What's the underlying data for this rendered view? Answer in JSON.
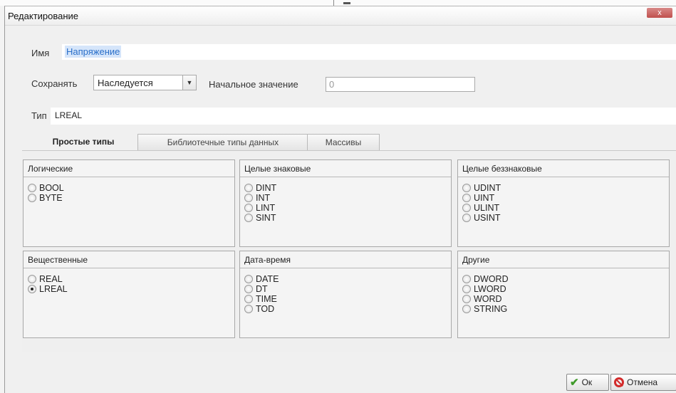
{
  "window": {
    "title": "Редактирование",
    "close_label": "x"
  },
  "form": {
    "name_label": "Имя",
    "name_value": "Напряжение",
    "save_label": "Сохранять",
    "save_value": "Наследуется",
    "initial_label": "Начальное значение",
    "initial_placeholder": "0",
    "type_label": "Тип",
    "type_value": "LREAL"
  },
  "tabs": [
    "Простые типы",
    "Библиотечные типы данных",
    "Массивы"
  ],
  "groups": [
    {
      "title": "Логические",
      "options": [
        "BOOL",
        "BYTE"
      ]
    },
    {
      "title": "Целые знаковые",
      "options": [
        "DINT",
        "INT",
        "LINT",
        "SINT"
      ]
    },
    {
      "title": "Целые беззнаковые",
      "options": [
        "UDINT",
        "UINT",
        "ULINT",
        "USINT"
      ]
    },
    {
      "title": "Вещественные",
      "options": [
        "REAL",
        "LREAL"
      ],
      "selected": "LREAL"
    },
    {
      "title": "Дата-время",
      "options": [
        "DATE",
        "DT",
        "TIME",
        "TOD"
      ]
    },
    {
      "title": "Другие",
      "options": [
        "DWORD",
        "LWORD",
        "WORD",
        "STRING"
      ]
    }
  ],
  "buttons": {
    "ok_label": "Ок",
    "cancel_label": "Отмена"
  },
  "colors": {
    "link_blue": "#2a6fc9",
    "close_red": "#c0504d",
    "ok_green": "#3f9a2a",
    "cancel_red": "#d22b2b"
  }
}
